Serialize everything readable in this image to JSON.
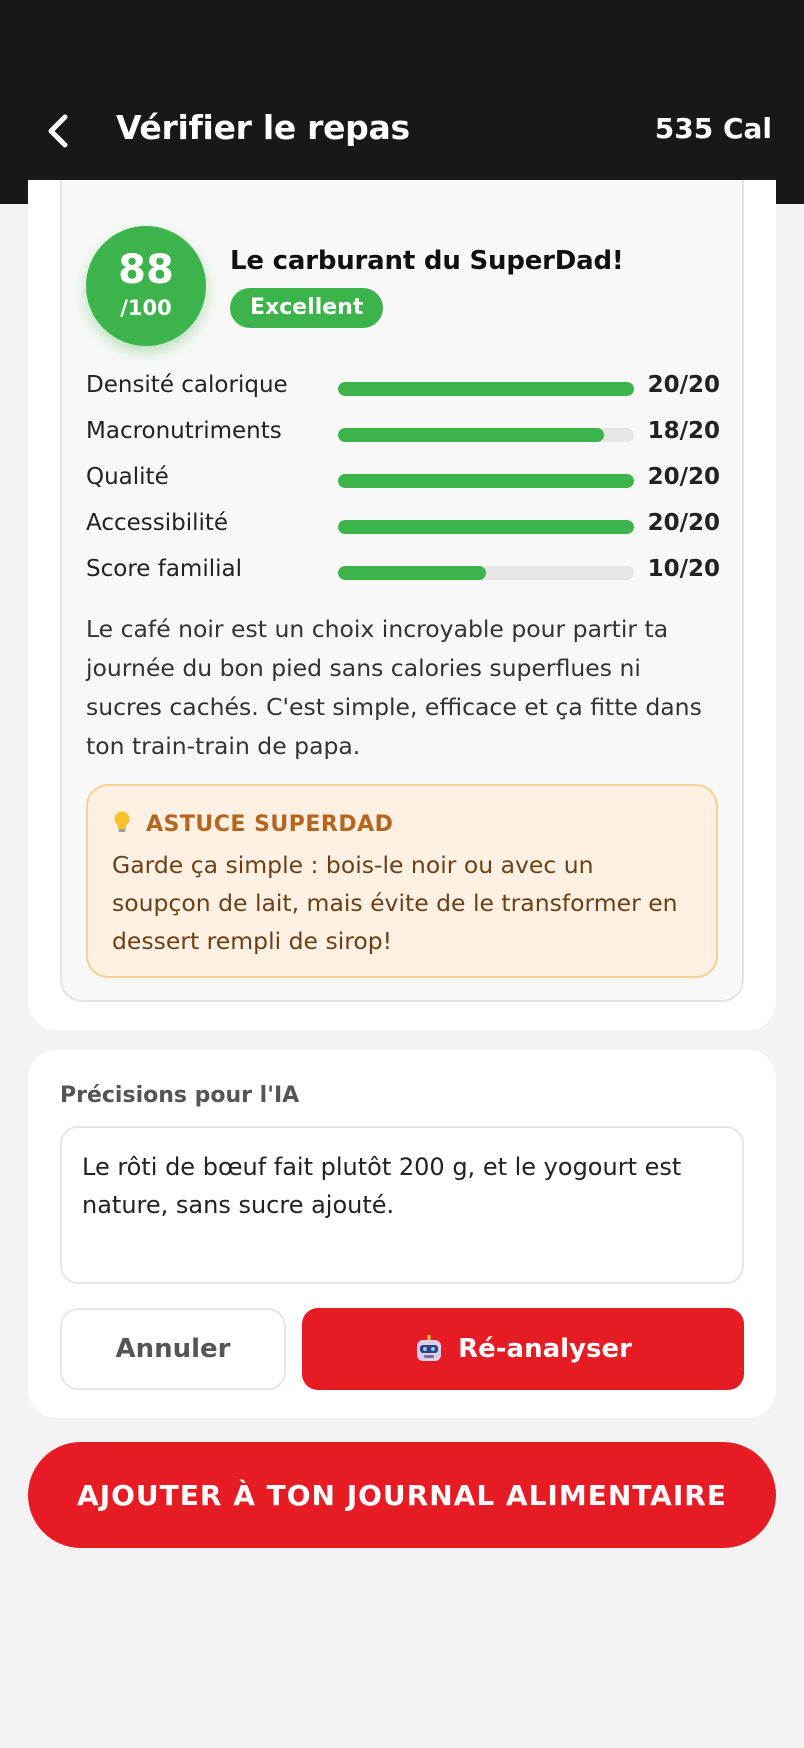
{
  "header": {
    "title": "Vérifier le repas",
    "calories": "535 Cal",
    "back_icon": "chevron-left-icon"
  },
  "score": {
    "value": "88",
    "max": "/100",
    "heading": "Le carburant du SuperDad!",
    "badge": "Excellent",
    "color": "#3cb44b"
  },
  "metrics": [
    {
      "label": "Densité calorique",
      "value": "20/20",
      "ratio": 1.0
    },
    {
      "label": "Macronutriments",
      "value": "18/20",
      "ratio": 0.9
    },
    {
      "label": "Qualité",
      "value": "20/20",
      "ratio": 1.0
    },
    {
      "label": "Accessibilité",
      "value": "20/20",
      "ratio": 1.0
    },
    {
      "label": "Score familial",
      "value": "10/20",
      "ratio": 0.5
    }
  ],
  "description": "Le café noir est un choix incroyable pour partir ta journée du bon pied sans calories superflues ni sucres cachés. C'est simple, efficace et ça fitte dans ton train-train de papa.",
  "tip": {
    "icon": "lightbulb-icon",
    "title": "ASTUCE SUPERDAD",
    "text": "Garde ça simple : bois-le noir ou avec un soupçon de lait, mais évite de le transformer en dessert rempli de sirop!"
  },
  "ai": {
    "label": "Précisions pour l'IA",
    "input_value": "Le rôti de bœuf fait plutôt 200 g, et le yogourt est nature, sans sucre ajouté.",
    "cancel_label": "Annuler",
    "reanalyze_label": "Ré-analyser",
    "reanalyze_icon": "robot-icon"
  },
  "add_button_label": "AJOUTER À TON JOURNAL ALIMENTAIRE",
  "colors": {
    "accent_red": "#e61b24",
    "success_green": "#3cb44b",
    "tip_bg": "#fef0e2",
    "tip_title": "#b5651d"
  }
}
